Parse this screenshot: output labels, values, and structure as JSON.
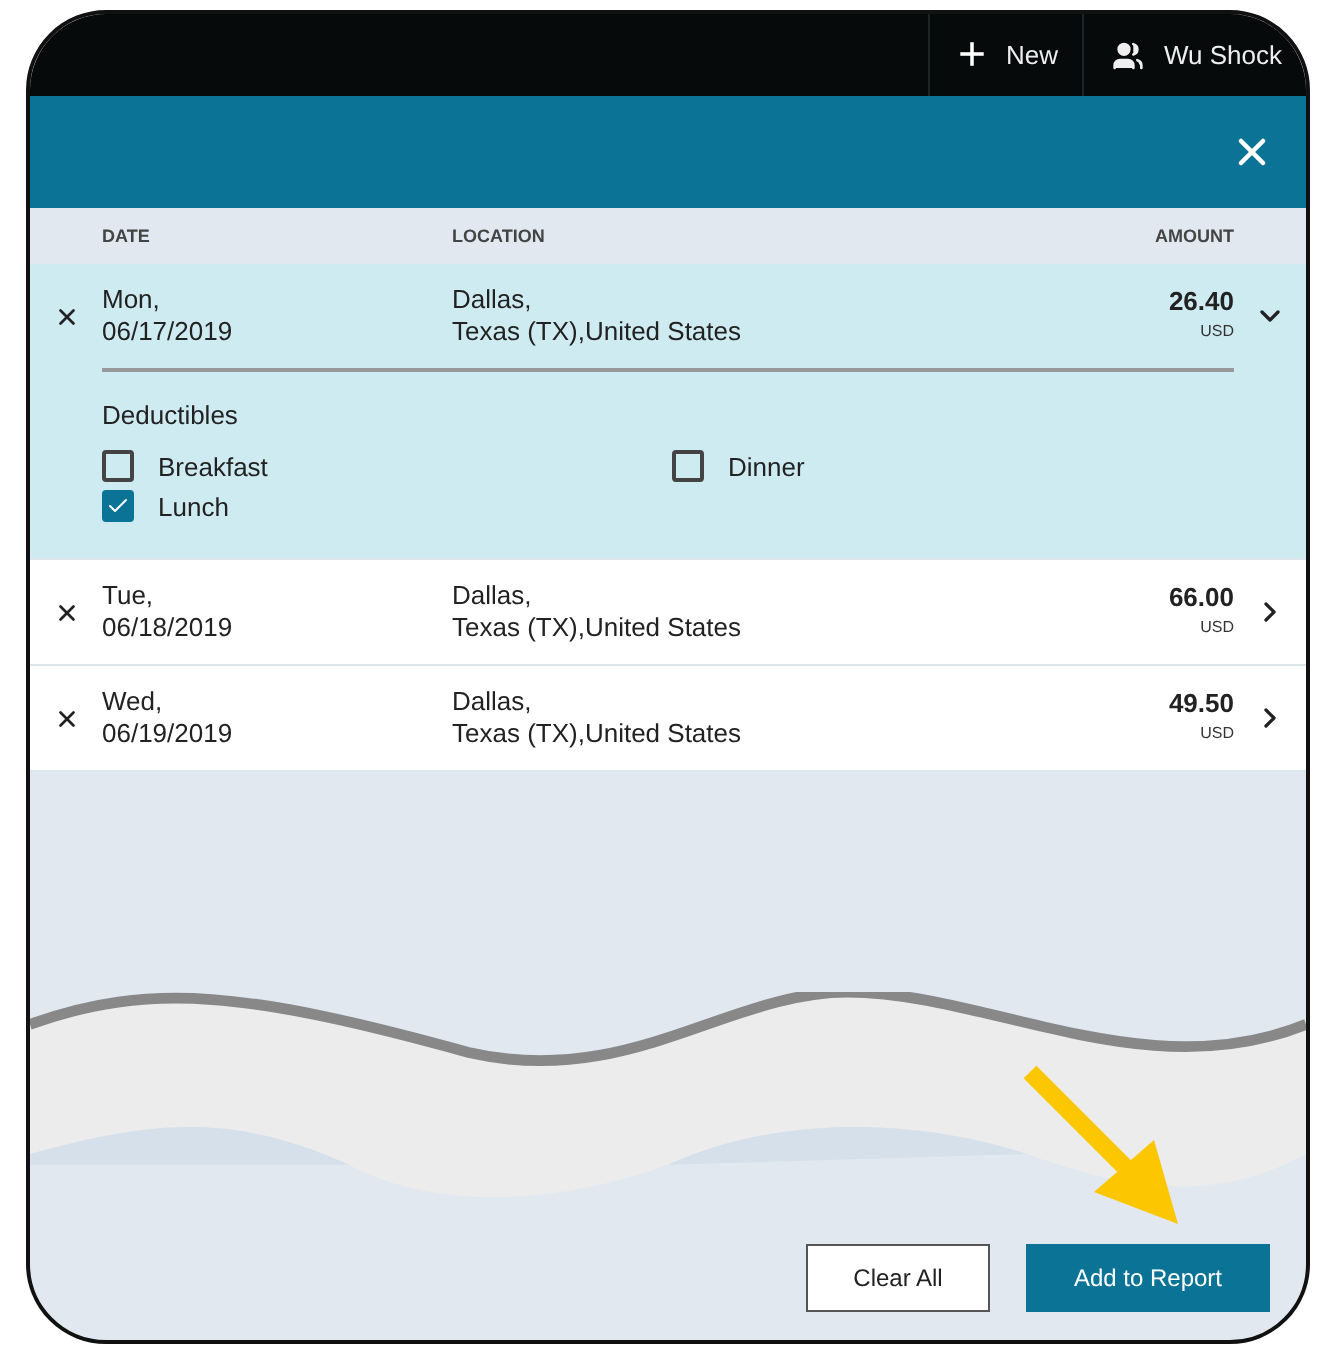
{
  "top_bar": {
    "new_button": {
      "icon": "+",
      "label": "New"
    },
    "user": {
      "name": "Wu Shock"
    }
  },
  "columns": [
    "DATE",
    "LOCATION",
    "AMOUNT"
  ],
  "rows": [
    {
      "day": "Mon,",
      "date": "06/17/2019",
      "city": "Dallas,",
      "region": "Texas (TX),United States",
      "amount": "26.40",
      "currency": "USD",
      "expanded": true,
      "deductibles": {
        "title": "Deductibles",
        "items": [
          {
            "label": "Breakfast",
            "checked": false
          },
          {
            "label": "Dinner",
            "checked": false
          },
          {
            "label": "Lunch",
            "checked": true
          }
        ]
      }
    },
    {
      "day": "Tue,",
      "date": "06/18/2019",
      "city": "Dallas,",
      "region": "Texas (TX),United States",
      "amount": "66.00",
      "currency": "USD",
      "expanded": false
    },
    {
      "day": "Wed,",
      "date": "06/19/2019",
      "city": "Dallas,",
      "region": "Texas (TX),United States",
      "amount": "49.50",
      "currency": "USD",
      "expanded": false
    }
  ],
  "buttons": [
    {
      "label": "Clear All",
      "kind": "secondary"
    },
    {
      "label": "Add to Report",
      "kind": "primary"
    }
  ]
}
